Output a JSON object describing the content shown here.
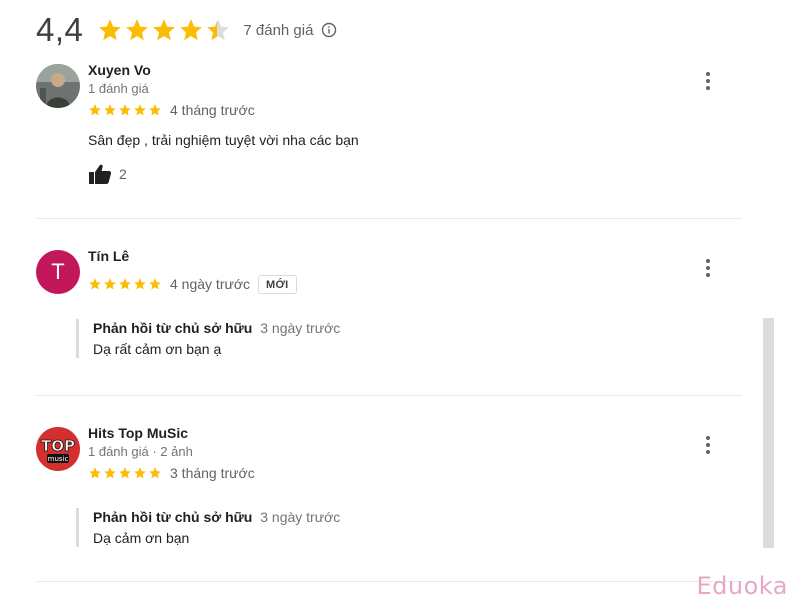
{
  "summary": {
    "score": "4,4",
    "stars_filled": 4.4,
    "count_label": "7 đánh giá",
    "star_color": "#fbbc04",
    "info_icon": "info-icon"
  },
  "reviews": [
    {
      "name": "Xuyen Vo",
      "meta": "1 đánh giá",
      "rating": 5,
      "time": "4 tháng trước",
      "text": "Sân đẹp , trải nghiệm tuyệt vời nha các bạn",
      "likes": "2",
      "avatar_icon": "photo-avatar"
    },
    {
      "name": "Tín Lê",
      "rating": 5,
      "time": "4 ngày trước",
      "badge": "MỚI",
      "avatar_letter": "T",
      "avatar_color": "#c2185b",
      "reply": {
        "title": "Phản hồi từ chủ sở hữu",
        "time": "3 ngày trước",
        "text": "Dạ rất cảm ơn bạn ạ"
      }
    },
    {
      "name": "Hits Top MuSic",
      "meta": "1 đánh giá · 2 ảnh",
      "rating": 5,
      "time": "3 tháng trước",
      "avatar_logo": "TOP",
      "avatar_logo_sub": "music",
      "avatar_color": "#d32f2f",
      "reply": {
        "title": "Phản hồi từ chủ sở hữu",
        "time": "3 ngày trước",
        "text": "Dạ cảm ơn bạn"
      }
    }
  ],
  "watermark": "Eduoka"
}
